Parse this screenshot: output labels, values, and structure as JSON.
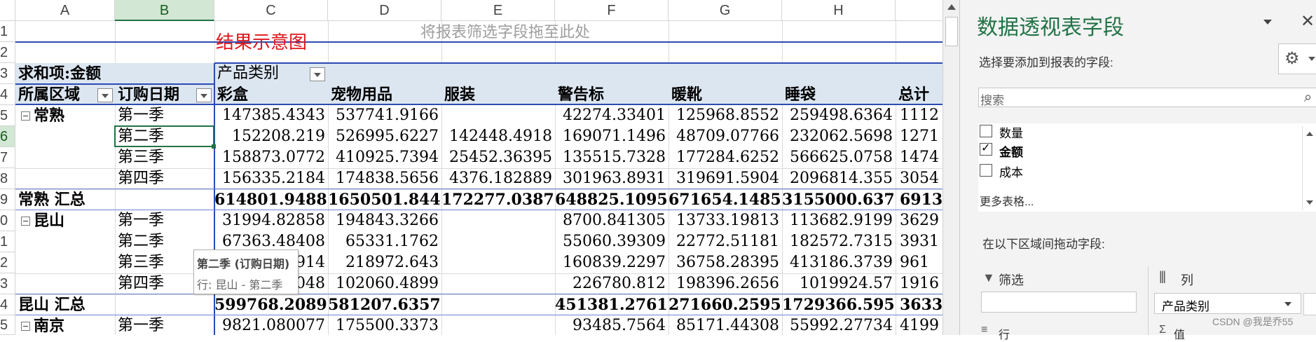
{
  "sheet": {
    "columns": [
      "A",
      "B",
      "C",
      "D",
      "E",
      "F",
      "G",
      "H"
    ],
    "rows": [
      "1",
      "2",
      "3",
      "4",
      "5",
      "6",
      "7",
      "8",
      "9",
      "0",
      "1",
      "2",
      "3",
      "4",
      "5"
    ],
    "placeholder": "将报表筛选字段拖至此处",
    "title_label": "结果示意图",
    "sum_label": "求和项:金额",
    "product_header": "产品类别",
    "region_header": "所属区域",
    "date_header": "订购日期",
    "categories": [
      "彩盒",
      "宠物用品",
      "服装",
      "警告标",
      "暖靴",
      "睡袋",
      "总计"
    ],
    "body": [
      {
        "group": "常熟",
        "season": "第一季",
        "vals": [
          "147385.4343",
          "537741.9166",
          "",
          "42274.33401",
          "125968.8552",
          "259498.6364",
          "1112"
        ]
      },
      {
        "group": "",
        "season": "第二季",
        "vals": [
          "152208.219",
          "526995.6227",
          "142448.4918",
          "169071.1496",
          "48709.07766",
          "232062.5698",
          "1271"
        ]
      },
      {
        "group": "",
        "season": "第三季",
        "vals": [
          "158873.0772",
          "410925.7394",
          "25452.36395",
          "135515.7328",
          "177284.6252",
          "566625.0758",
          "1474"
        ]
      },
      {
        "group": "",
        "season": "第四季",
        "vals": [
          "156335.2184",
          "174838.5656",
          "4376.182889",
          "301963.8931",
          "319691.5904",
          "2096814.355",
          "3054"
        ]
      },
      {
        "subtotal": "常熟 汇总",
        "vals": [
          "614801.9488",
          "1650501.844",
          "172277.0387",
          "648825.1095",
          "671654.1485",
          "3155000.637",
          "6913"
        ]
      },
      {
        "group": "昆山",
        "season": "第一季",
        "vals": [
          "31994.82858",
          "194843.3266",
          "",
          "8700.841305",
          "13733.19813",
          "113682.9199",
          "3629"
        ]
      },
      {
        "group": "",
        "season": "第二季",
        "vals": [
          "67363.48408",
          "65331.1762",
          "",
          "55060.39309",
          "22772.51181",
          "182572.7315",
          "3931"
        ]
      },
      {
        "group": "",
        "season": "第三季",
        "vals": [
          "914",
          "218972.643",
          "",
          "160839.2297",
          "36758.28395",
          "413186.3739",
          "961"
        ]
      },
      {
        "group": "",
        "season": "第四季",
        "vals": [
          "048",
          "102060.4899",
          "",
          "226780.812",
          "198396.2656",
          "1019924.57",
          "1916"
        ]
      },
      {
        "subtotal": "昆山 汇总",
        "vals": [
          "599768.2089",
          "581207.6357",
          "",
          "451381.2761",
          "271660.2595",
          "1729366.595",
          "3633"
        ]
      },
      {
        "group": "南京",
        "season": "第一季",
        "vals": [
          "9821.080077",
          "175500.3373",
          "",
          "93485.7564",
          "85171.44308",
          "55992.27734",
          "4199"
        ]
      }
    ],
    "tooltip": {
      "title": "第二季 (订购日期)",
      "body": "行: 昆山 - 第二季"
    }
  },
  "pane": {
    "title": "数据透视表字段",
    "choose_label": "选择要添加到报表的字段:",
    "search_placeholder": "搜索",
    "fields": [
      {
        "label": "数量",
        "checked": false
      },
      {
        "label": "金额",
        "checked": true
      },
      {
        "label": "成本",
        "checked": false
      }
    ],
    "more_tables": "更多表格...",
    "drag_label": "在以下区域间拖动字段:",
    "filter_label": "筛选",
    "columns_label": "列",
    "column_value": "产品类别",
    "rows_label": "行",
    "values_label": "值",
    "watermark": "CSDN @我是乔55"
  },
  "colors": {
    "accent": "#217346",
    "pivot_blue": "#2b4bb3",
    "title_red": "#e0171c",
    "header_fill": "#dce6f1"
  }
}
